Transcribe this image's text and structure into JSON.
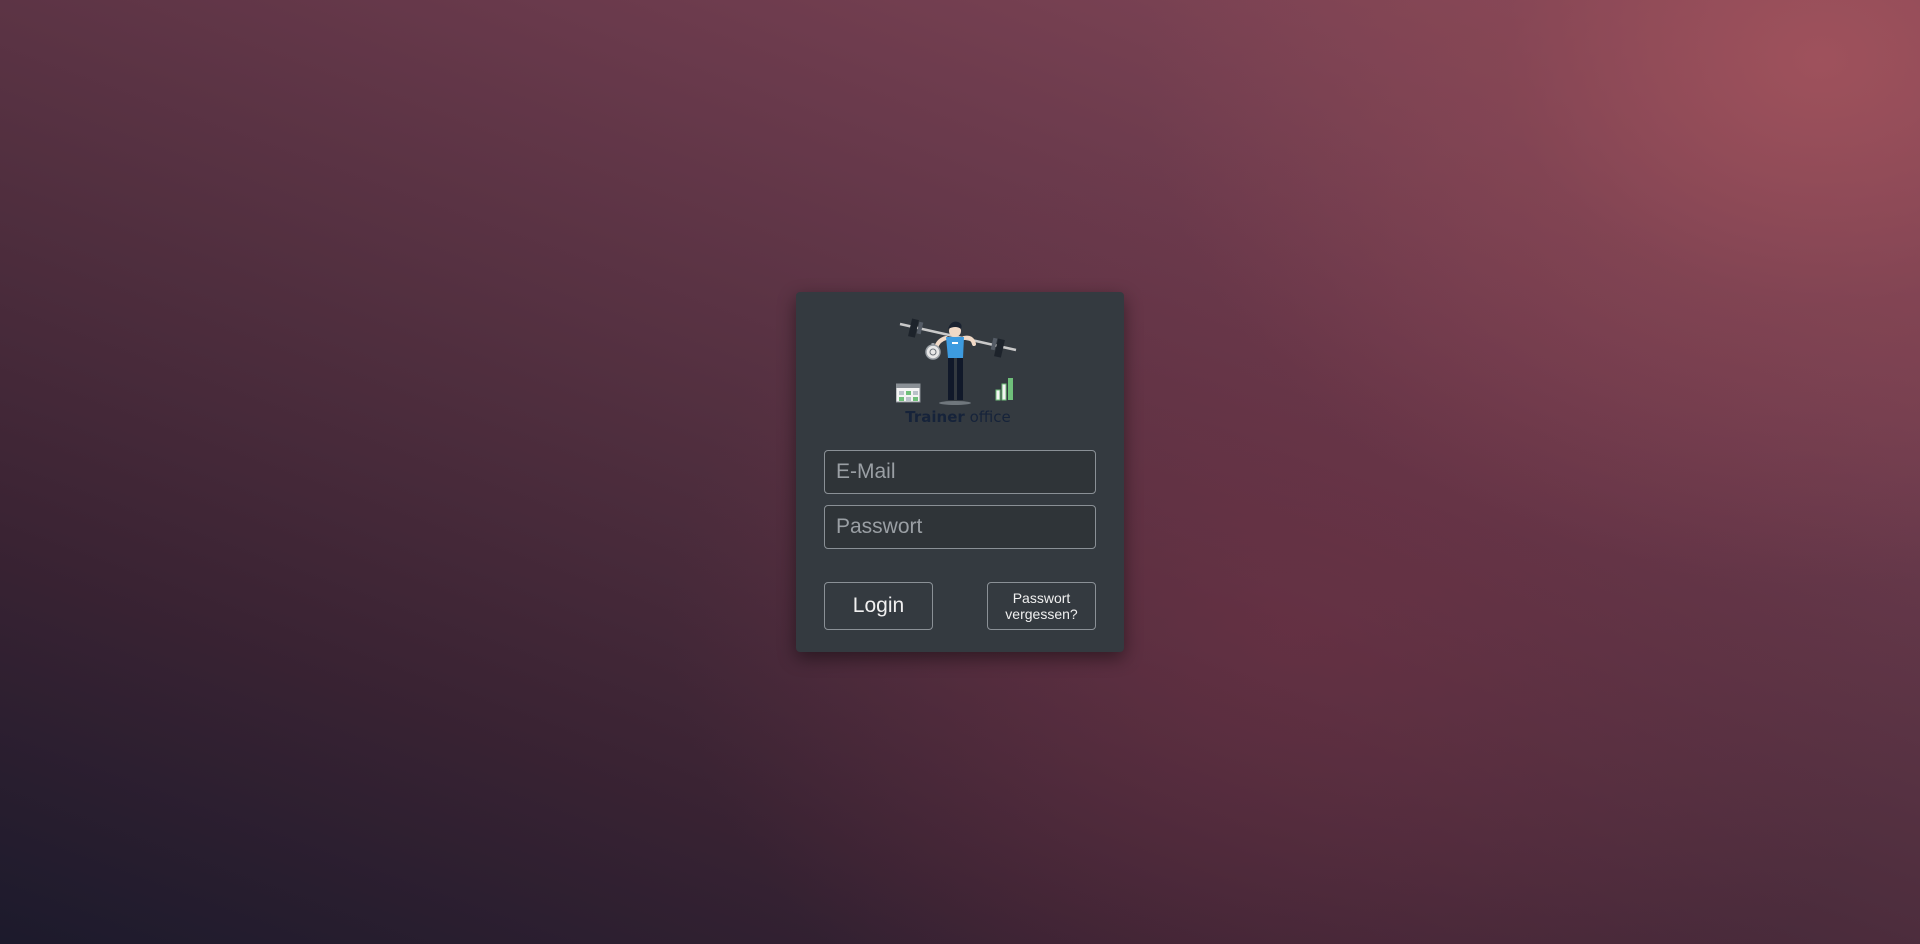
{
  "logo": {
    "text_bold": "Trainer",
    "text_regular": "office",
    "icon": "weightlifter-logo-icon"
  },
  "form": {
    "email_placeholder": "E-Mail",
    "password_placeholder": "Passwort",
    "login_label": "Login",
    "forgot_line1": "Passwort",
    "forgot_line2": "vergessen?"
  },
  "colors": {
    "card": "#343a40",
    "logo_shirt": "#3d9be0",
    "logo_accent_green": "#6fbf7a",
    "logo_text": "#16233a"
  }
}
